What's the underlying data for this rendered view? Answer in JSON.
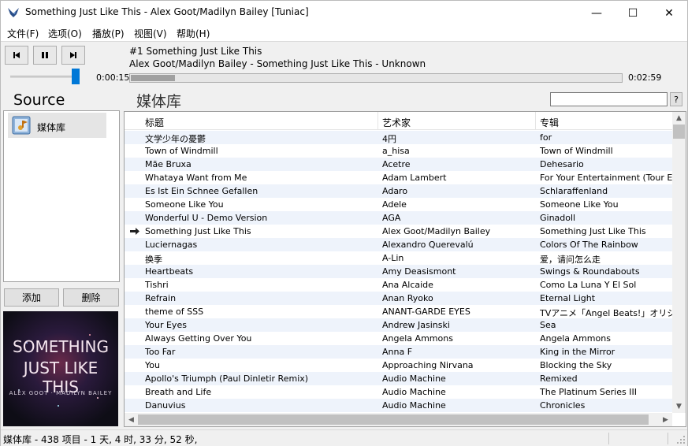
{
  "window": {
    "title": "Something Just Like This - Alex Goot/Madilyn Bailey [Tuniac]",
    "min_glyph": "—",
    "max_glyph": "☐",
    "close_glyph": "✕"
  },
  "menu": [
    "文件(F)",
    "选项(O)",
    "播放(P)",
    "视图(V)",
    "帮助(H)"
  ],
  "player": {
    "now_title": "#1 Something Just Like This",
    "now_sub": "Alex Goot/Madilyn Bailey - Something Just Like This - Unknown",
    "elapsed": "0:00:15",
    "total": "0:02:59",
    "progress": 0.09,
    "volume": 1.0
  },
  "source": {
    "heading": "Source",
    "items": [
      {
        "label": "媒体库",
        "icon": "media-library-icon"
      }
    ],
    "add_label": "添加",
    "delete_label": "删除"
  },
  "album_art": {
    "line1": "SOMETHING",
    "line2": "JUST LIKE THIS",
    "line3": "ALEX GOOT · MADILYN BAILEY"
  },
  "library": {
    "heading": "媒体库",
    "search_value": "",
    "help_label": "?",
    "columns": [
      "标题",
      "艺术家",
      "专辑"
    ],
    "playing_index": 7,
    "rows": [
      [
        "文学少年の憂鬱",
        "4円",
        "for"
      ],
      [
        "Town of Windmill",
        "a_hisa",
        "Town of Windmill"
      ],
      [
        "Mãe Bruxa",
        "Acetre",
        "Dehesario"
      ],
      [
        "Whataya Want from Me",
        "Adam Lambert",
        "For Your Entertainment (Tour Edition)"
      ],
      [
        "Es Ist Ein Schnee Gefallen",
        "Adaro",
        "Schlaraffenland"
      ],
      [
        "Someone Like You",
        "Adele",
        "Someone Like You"
      ],
      [
        "Wonderful U - Demo Version",
        "AGA",
        "Ginadoll"
      ],
      [
        "Something Just Like This",
        "Alex Goot/Madilyn Bailey",
        "Something Just Like This"
      ],
      [
        "Luciernagas",
        "Alexandro Querevalú",
        "Colors Of The Rainbow"
      ],
      [
        "换季",
        "A-Lin",
        "爱，请问怎么走"
      ],
      [
        "Heartbeats",
        "Amy Deasismont",
        "Swings & Roundabouts"
      ],
      [
        "Tishri",
        "Ana Alcaide",
        "Como La Luna Y El Sol"
      ],
      [
        "Refrain",
        "Anan Ryoko",
        "Eternal Light"
      ],
      [
        "theme of SSS",
        "ANANT-GARDE EYES",
        "TVアニメ「Angel Beats!」オリジナル"
      ],
      [
        "Your Eyes",
        "Andrew Jasinski",
        "Sea"
      ],
      [
        "Always Getting Over You",
        "Angela Ammons",
        "Angela Ammons"
      ],
      [
        "Too Far",
        "Anna F",
        "King in the Mirror"
      ],
      [
        "You",
        "Approaching Nirvana",
        "Blocking the Sky"
      ],
      [
        "Apollo's Triumph (Paul Dinletir Remix)",
        "Audio Machine",
        "Remixed"
      ],
      [
        "Breath and Life",
        "Audio Machine",
        "The Platinum Series III"
      ],
      [
        "Danuvius",
        "Audio Machine",
        "Chronicles"
      ]
    ]
  },
  "status": {
    "text": "媒体库 - 438 项目 - 1 天, 4 时, 33 分, 52 秒,"
  }
}
